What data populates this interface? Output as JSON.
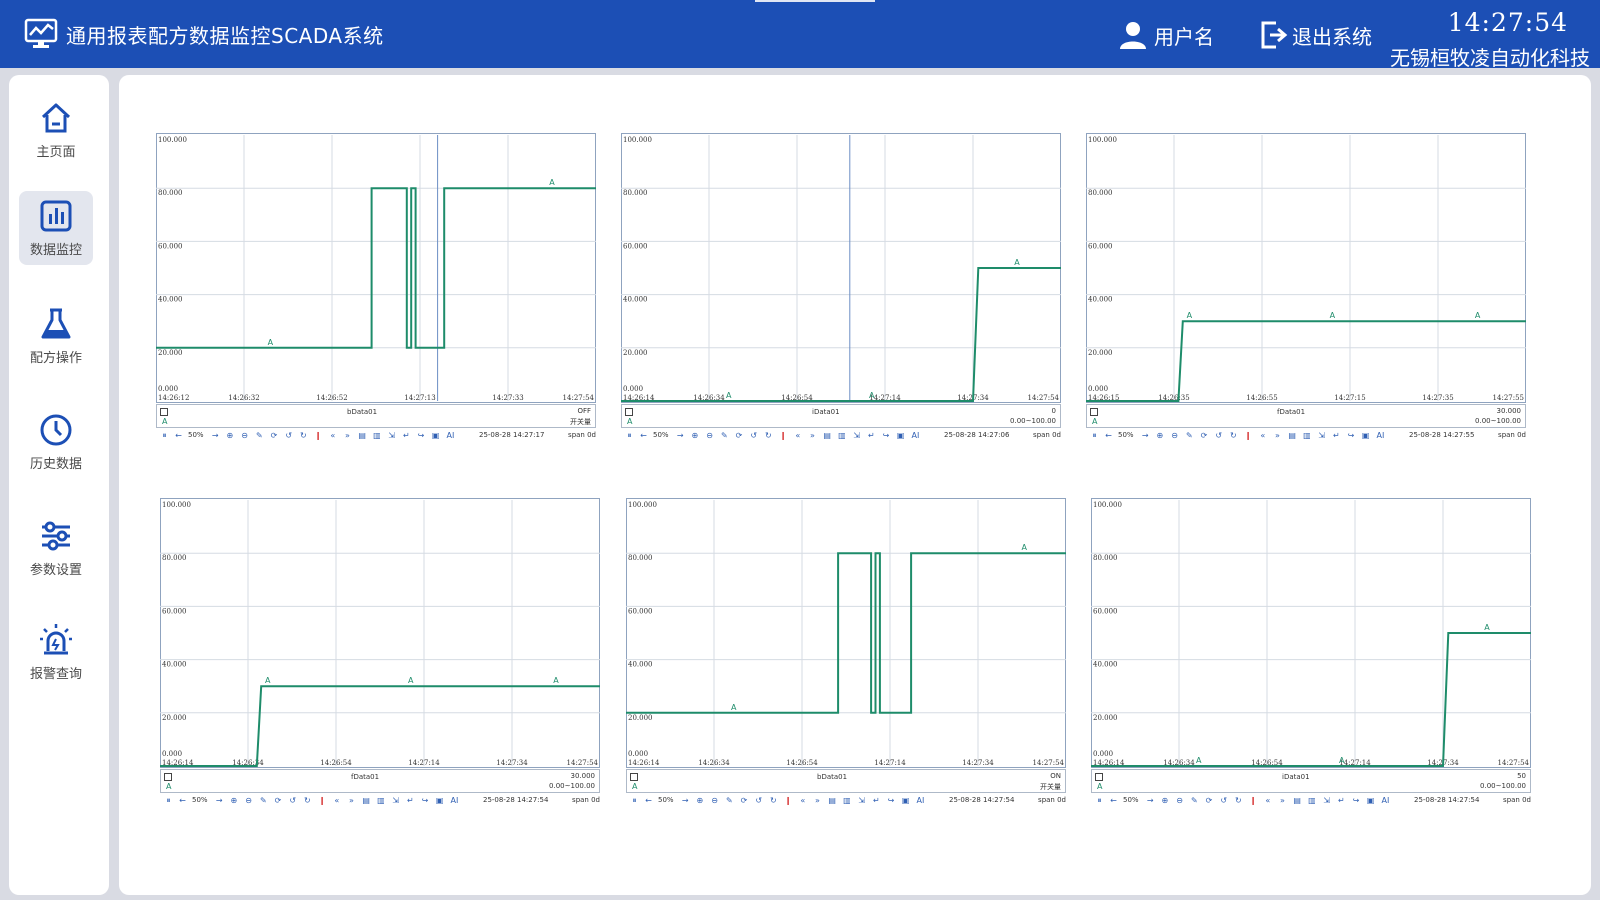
{
  "header": {
    "title": "通用报表配方数据监控SCADA系统",
    "user_label": "用户名",
    "logout_label": "退出系统",
    "time": "14:27:54",
    "company": "无锡桓牧凌自动化科技",
    "bg_color": "#1c4fb5"
  },
  "sidebar": {
    "items": [
      {
        "label": "主页面",
        "icon": "home-icon",
        "active": false
      },
      {
        "label": "数据监控",
        "icon": "bar-chart-icon",
        "active": true
      },
      {
        "label": "配方操作",
        "icon": "flask-icon",
        "active": false
      },
      {
        "label": "历史数据",
        "icon": "clock-icon",
        "active": false
      },
      {
        "label": "参数设置",
        "icon": "sliders-icon",
        "active": false
      },
      {
        "label": "报警查询",
        "icon": "alarm-light-icon",
        "active": false
      }
    ]
  },
  "toolbar": {
    "zoom": "50%"
  },
  "series_color": "#1e8c6a",
  "chart_data": [
    {
      "type": "line",
      "y_ticks": [
        "100.000",
        "80.000",
        "60.000",
        "40.000",
        "20.000",
        "0.000"
      ],
      "ylim": [
        0,
        100
      ],
      "x_ticks": [
        "14:26:12",
        "14:26:32",
        "14:26:52",
        "14:27:13",
        "14:27:33",
        "14:27:54"
      ],
      "grid": true,
      "cursor_x": 0.64,
      "marker_label": "A",
      "markers": [
        0.26,
        0.9
      ],
      "points": [
        [
          0,
          20
        ],
        [
          0.49,
          20
        ],
        [
          0.49,
          80
        ],
        [
          0.57,
          80
        ],
        [
          0.57,
          20
        ],
        [
          0.58,
          20
        ],
        [
          0.58,
          80
        ],
        [
          0.59,
          80
        ],
        [
          0.59,
          20
        ],
        [
          0.655,
          20
        ],
        [
          0.655,
          80
        ],
        [
          1,
          80
        ]
      ],
      "series_name": "bData01",
      "current_value": "OFF",
      "range_text": "开关量",
      "date": "25-08-28 14:27:17",
      "span": "span 0d"
    },
    {
      "type": "line",
      "y_ticks": [
        "100.000",
        "80.000",
        "60.000",
        "40.000",
        "20.000",
        "0.000"
      ],
      "ylim": [
        0,
        100
      ],
      "x_ticks": [
        "14:26:14",
        "14:26:34",
        "14:26:54",
        "14:27:14",
        "14:27:34",
        "14:27:54"
      ],
      "grid": true,
      "cursor_x": 0.52,
      "marker_label": "A",
      "markers": [
        0.245,
        0.57,
        0.9
      ],
      "points": [
        [
          0,
          0
        ],
        [
          0.8,
          0
        ],
        [
          0.812,
          50
        ],
        [
          1,
          50
        ]
      ],
      "series_name": "iData01",
      "current_value": "0",
      "range_text": "0.00~100.00",
      "date": "25-08-28 14:27:06",
      "span": "span 0d"
    },
    {
      "type": "line",
      "y_ticks": [
        "100.000",
        "80.000",
        "60.000",
        "40.000",
        "20.000",
        "0.000"
      ],
      "ylim": [
        0,
        100
      ],
      "x_ticks": [
        "14:26:15",
        "14:26:35",
        "14:26:55",
        "14:27:15",
        "14:27:35",
        "14:27:55"
      ],
      "grid": true,
      "cursor_x": null,
      "marker_label": "A",
      "markers": [
        0.235,
        0.56,
        0.89
      ],
      "points": [
        [
          0,
          0
        ],
        [
          0.21,
          0
        ],
        [
          0.22,
          30
        ],
        [
          1,
          30
        ]
      ],
      "series_name": "fData01",
      "current_value": "30.000",
      "range_text": "0.00~100.00",
      "date": "25-08-28 14:27:55",
      "span": "span 0d"
    },
    {
      "type": "line",
      "y_ticks": [
        "100.000",
        "80.000",
        "60.000",
        "40.000",
        "20.000",
        "0.000"
      ],
      "ylim": [
        0,
        100
      ],
      "x_ticks": [
        "14:26:14",
        "14:26:34",
        "14:26:54",
        "14:27:14",
        "14:27:34",
        "14:27:54"
      ],
      "grid": true,
      "cursor_x": null,
      "marker_label": "A",
      "markers": [
        0.245,
        0.57,
        0.9
      ],
      "points": [
        [
          0,
          0
        ],
        [
          0.22,
          0
        ],
        [
          0.23,
          30
        ],
        [
          1,
          30
        ]
      ],
      "series_name": "fData01",
      "current_value": "30.000",
      "range_text": "0.00~100.00",
      "date": "25-08-28 14:27:54",
      "span": "span 0d"
    },
    {
      "type": "line",
      "y_ticks": [
        "100.000",
        "80.000",
        "60.000",
        "40.000",
        "20.000",
        "0.000"
      ],
      "ylim": [
        0,
        100
      ],
      "x_ticks": [
        "14:26:14",
        "14:26:34",
        "14:26:54",
        "14:27:14",
        "14:27:34",
        "14:27:54"
      ],
      "grid": true,
      "cursor_x": null,
      "marker_label": "A",
      "markers": [
        0.245,
        0.905
      ],
      "points": [
        [
          0,
          20
        ],
        [
          0.482,
          20
        ],
        [
          0.482,
          80
        ],
        [
          0.557,
          80
        ],
        [
          0.557,
          20
        ],
        [
          0.567,
          20
        ],
        [
          0.567,
          80
        ],
        [
          0.577,
          80
        ],
        [
          0.577,
          20
        ],
        [
          0.648,
          20
        ],
        [
          0.648,
          80
        ],
        [
          1,
          80
        ]
      ],
      "series_name": "bData01",
      "current_value": "ON",
      "range_text": "开关量",
      "date": "25-08-28 14:27:54",
      "span": "span 0d"
    },
    {
      "type": "line",
      "y_ticks": [
        "100.000",
        "80.000",
        "60.000",
        "40.000",
        "20.000",
        "0.000"
      ],
      "ylim": [
        0,
        100
      ],
      "x_ticks": [
        "14:26:14",
        "14:26:34",
        "14:26:54",
        "14:27:14",
        "14:27:34",
        "14:27:54"
      ],
      "grid": true,
      "cursor_x": null,
      "marker_label": "A",
      "markers": [
        0.245,
        0.57,
        0.9
      ],
      "points": [
        [
          0,
          0
        ],
        [
          0.8,
          0
        ],
        [
          0.812,
          50
        ],
        [
          1,
          50
        ]
      ],
      "series_name": "iData01",
      "current_value": "50",
      "range_text": "0.00~100.00",
      "date": "25-08-28 14:27:54",
      "span": "span 0d"
    }
  ]
}
